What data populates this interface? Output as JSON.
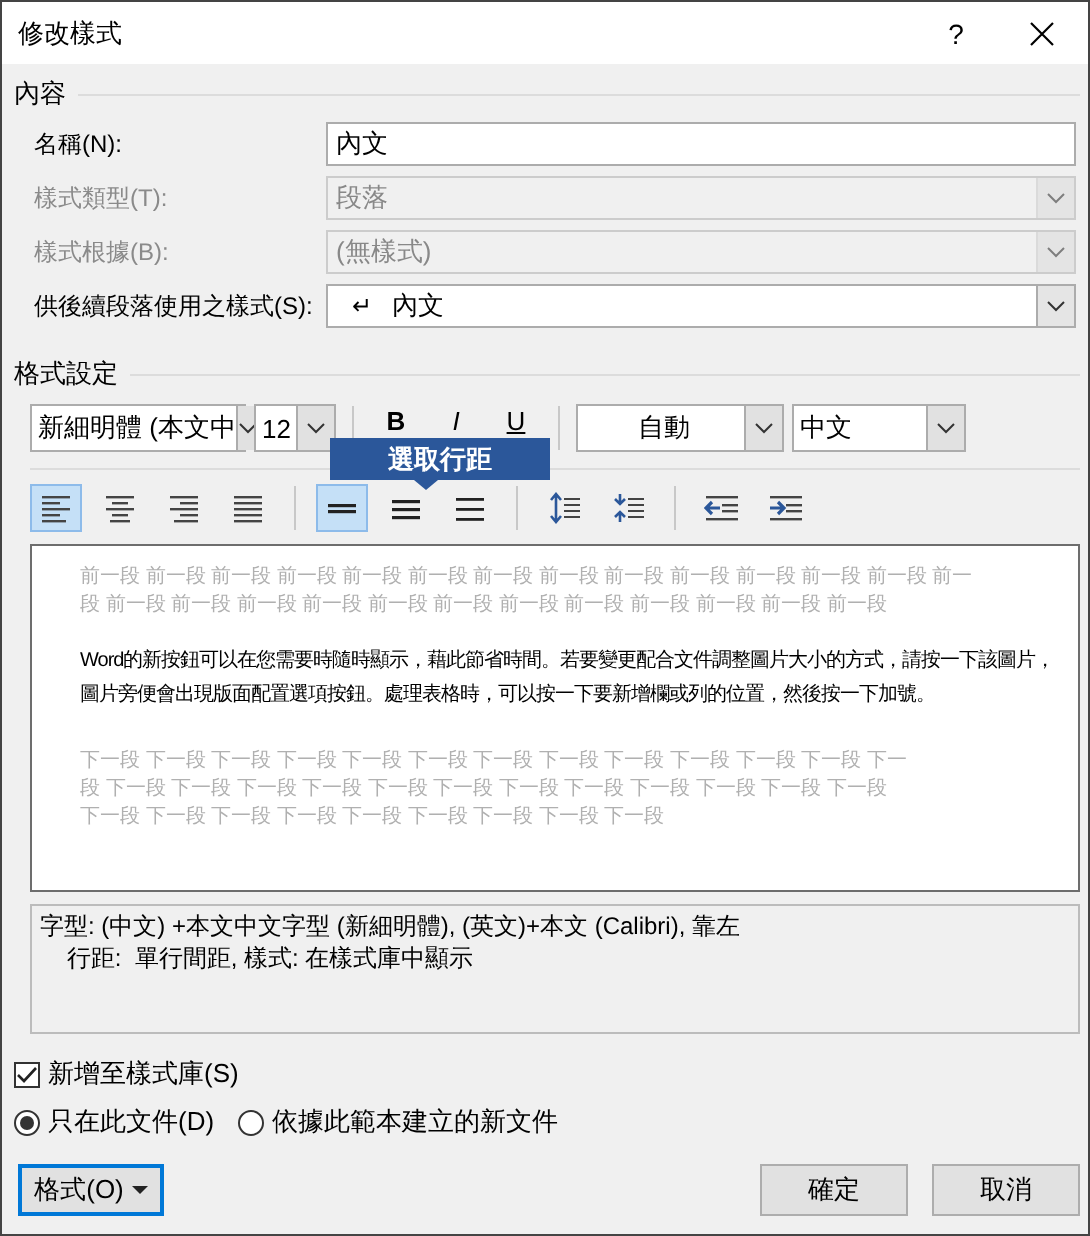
{
  "window": {
    "title": "修改樣式",
    "help": "?"
  },
  "properties": {
    "heading": "內容",
    "rows": [
      {
        "kind": "text",
        "label": "名稱(N):",
        "value": "內文",
        "disabled": false
      },
      {
        "kind": "select",
        "label": "樣式類型(T):",
        "value": "段落",
        "disabled": true
      },
      {
        "kind": "select",
        "label": "樣式根據(B):",
        "value": "(無樣式)",
        "disabled": true
      },
      {
        "kind": "select",
        "label": "供後續段落使用之樣式(S):",
        "prefix": "↵",
        "value": "內文",
        "disabled": false
      }
    ]
  },
  "formatting": {
    "heading": "格式設定",
    "font": "新細明體 (本文中",
    "size": "12",
    "styles": [
      {
        "kind": "bold",
        "label": "B",
        "selected": false
      },
      {
        "kind": "italic",
        "label": "I",
        "selected": false
      },
      {
        "kind": "underline",
        "label": "U",
        "selected": false
      }
    ],
    "font_color_label": "自動",
    "language": "中文",
    "alignment": [
      {
        "kind": "left",
        "selected": true
      },
      {
        "kind": "center",
        "selected": false
      },
      {
        "kind": "right",
        "selected": false
      },
      {
        "kind": "justify",
        "selected": false
      }
    ],
    "line_spacing": [
      {
        "kind": "single",
        "selected": true
      },
      {
        "kind": "one-half",
        "selected": false
      },
      {
        "kind": "double",
        "selected": false
      }
    ],
    "paragraph_spacing": [
      {
        "kind": "increase"
      },
      {
        "kind": "decrease"
      }
    ],
    "indent": [
      {
        "kind": "decrease"
      },
      {
        "kind": "increase"
      }
    ],
    "tooltip": "選取行距"
  },
  "preview": {
    "before_lines": [
      "前一段 前一段 前一段 前一段 前一段 前一段 前一段 前一段 前一段 前一段 前一段 前一段 前一段 前一",
      "段 前一段 前一段 前一段 前一段 前一段 前一段 前一段 前一段 前一段 前一段 前一段 前一段"
    ],
    "sample_lines": [
      "Word的新按鈕可以在您需要時隨時顯示，藉此節省時間。若要變更配合文件調整圖片大小的方式，請按一下該圖片，",
      "圖片旁便會出現版面配置選項按鈕。處理表格時，可以按一下要新增欄或列的位置，然後按一下加號。"
    ],
    "after_lines": [
      "下一段 下一段 下一段 下一段 下一段 下一段 下一段 下一段 下一段 下一段 下一段 下一段 下一",
      "段 下一段 下一段 下一段 下一段 下一段 下一段 下一段 下一段 下一段 下一段 下一段 下一段",
      "下一段 下一段 下一段 下一段 下一段 下一段 下一段 下一段 下一段"
    ]
  },
  "description": [
    "字型: (中文) +本文中文字型 (新細明體), (英文)+本文 (Calibri), 靠左",
    "行距:  單行間距, 樣式: 在樣式庫中顯示"
  ],
  "add_to_gallery": {
    "label": "新增至樣式庫(S)",
    "checked": true
  },
  "scope": [
    {
      "label": "只在此文件(D)",
      "selected": true
    },
    {
      "label": "依據此範本建立的新文件",
      "selected": false
    }
  ],
  "format_button": "格式(O)",
  "buttons": [
    "確定",
    "取消"
  ]
}
